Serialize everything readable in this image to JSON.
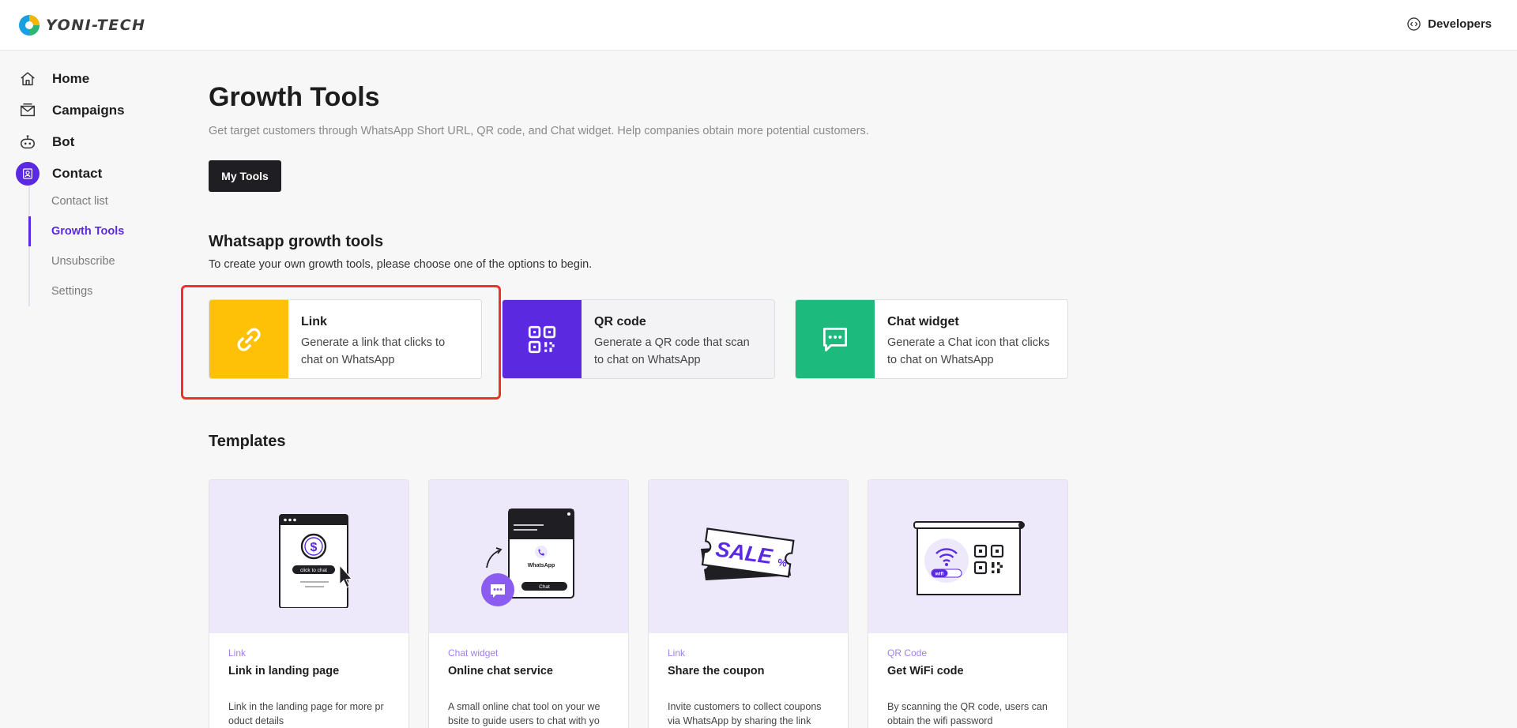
{
  "brand": {
    "name": "YONI-TECH"
  },
  "header": {
    "developers_label": "Developers"
  },
  "sidebar": {
    "items": [
      {
        "label": "Home",
        "icon": "home-icon"
      },
      {
        "label": "Campaigns",
        "icon": "campaigns-icon"
      },
      {
        "label": "Bot",
        "icon": "bot-icon"
      },
      {
        "label": "Contact",
        "icon": "contact-icon",
        "active": true
      }
    ],
    "sub_items": [
      {
        "label": "Contact list"
      },
      {
        "label": "Growth Tools",
        "active": true
      },
      {
        "label": "Unsubscribe"
      },
      {
        "label": "Settings"
      }
    ]
  },
  "page": {
    "title": "Growth Tools",
    "description": "Get target customers through WhatsApp Short URL, QR code, and Chat widget. Help companies obtain more potential customers.",
    "my_tools_label": "My Tools"
  },
  "growth_tools": {
    "title": "Whatsapp growth tools",
    "subtitle": "To create your own growth tools, please choose one of the options to begin.",
    "items": [
      {
        "name": "Link",
        "desc": "Generate a link that clicks to chat on WhatsApp",
        "color": "#ffc107",
        "icon": "link-icon"
      },
      {
        "name": "QR code",
        "desc": "Generate a QR code that scan to chat on WhatsApp",
        "color": "#5b2ae0",
        "icon": "qr-code-icon"
      },
      {
        "name": "Chat widget",
        "desc": "Generate a Chat icon that clicks to chat on WhatsApp",
        "color": "#1dba7e",
        "icon": "chat-bubble-icon"
      }
    ]
  },
  "templates": {
    "title": "Templates",
    "items": [
      {
        "category": "Link",
        "name": "Link in landing page",
        "desc": "Link in the landing page for more pr oduct details",
        "badge_text": "click to chat"
      },
      {
        "category": "Chat widget",
        "name": "Online chat service",
        "desc": "A small online chat tool on your we bsite to guide users to chat with yo",
        "mock_label": "WhatsApp",
        "mock_button": "Chat"
      },
      {
        "category": "Link",
        "name": "Share the coupon",
        "desc": "Invite customers to collect coupons via WhatsApp by sharing the link",
        "sale_text": "SALE"
      },
      {
        "category": "QR Code",
        "name": "Get WiFi code",
        "desc": "By scanning the QR code, users can obtain the wifi password",
        "wifi_label": "wifi"
      }
    ]
  }
}
